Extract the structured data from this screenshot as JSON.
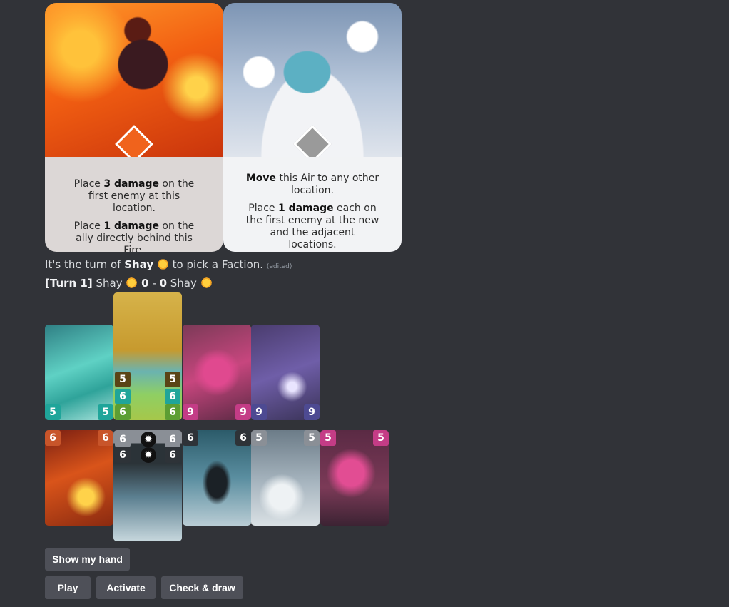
{
  "cards": {
    "fire": {
      "icon": "flame-icon",
      "line1_pre": "Place ",
      "line1_bold": "3 damage",
      "line1_post": " on the first enemy at this location.",
      "line2_pre": "Place ",
      "line2_bold": "1 damage",
      "line2_post": " on the ally directly behind this Fire."
    },
    "air": {
      "icon": "wind-icon",
      "line1_bold": "Move",
      "line1_post": " this Air to any other location.",
      "line2_pre": "Place ",
      "line2_bold": "1 damage",
      "line2_post": " each on the first enemy at the new and the adjacent locations."
    }
  },
  "message": {
    "turn_pre": "It's the turn of ",
    "player": "Shay",
    "turn_post": " to pick a Faction.",
    "edited": "(edited)",
    "score_turn": "[Turn 1]",
    "score_left_player": "Shay",
    "score_left": "0",
    "score_dash": " - ",
    "score_right": "0",
    "score_right_player": "Shay"
  },
  "board_row1": [
    {
      "name": "water-card",
      "top": "5",
      "bottom": "5",
      "color": "#1fa59a"
    },
    {
      "name": "earth-card",
      "top": "5",
      "bottom": "6",
      "color": "#7a5a1c"
    },
    {
      "name": "crystal-card",
      "top": "9",
      "bottom": "9",
      "color": "#c43c86"
    },
    {
      "name": "lightning-card",
      "top": "9",
      "bottom": "9",
      "color": "#4d4a92"
    }
  ],
  "board_row2": [
    {
      "name": "fire-card",
      "value": "6",
      "color": "#c8552a"
    },
    {
      "name": "shadow-card",
      "value": "6",
      "color": "#2e3338"
    },
    {
      "name": "shadow-card",
      "value": "6",
      "color": "#2e3338"
    },
    {
      "name": "air-card",
      "value": "5",
      "color": "#8a8f96"
    },
    {
      "name": "crystal-card",
      "value": "5",
      "color": "#c43c86"
    }
  ],
  "buttons": {
    "show_hand": "Show my hand",
    "play": "Play",
    "activate": "Activate",
    "check_draw": "Check & draw"
  }
}
